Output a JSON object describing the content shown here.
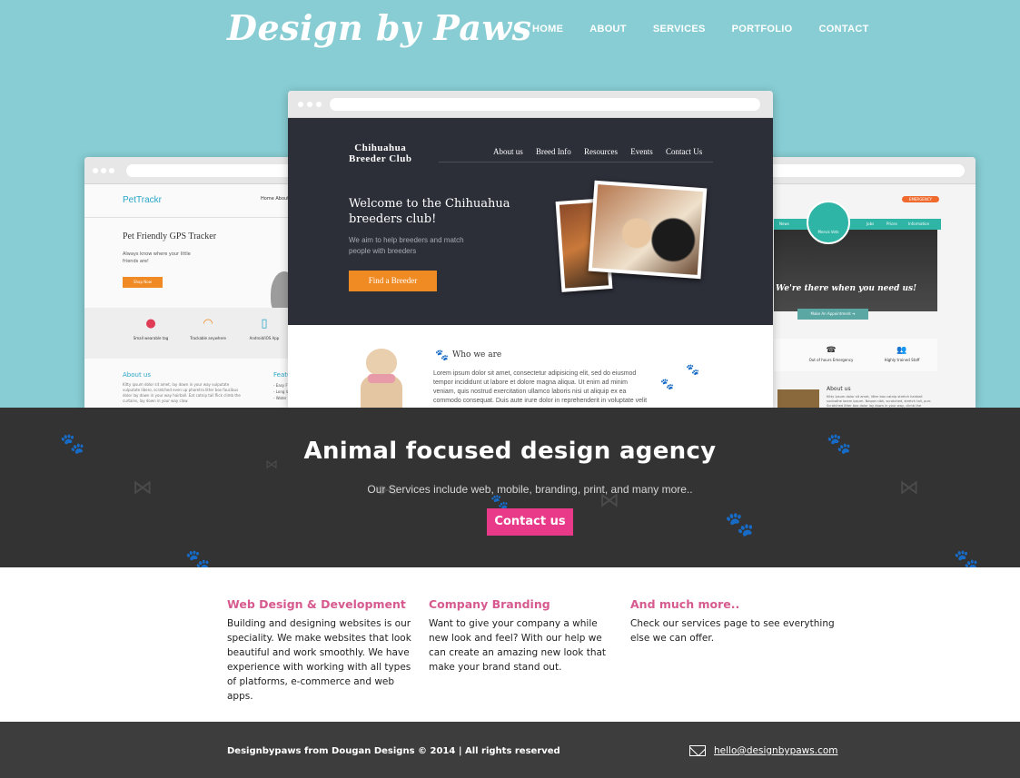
{
  "site": {
    "logo": "Design by Paws",
    "nav": [
      "HOME",
      "ABOUT",
      "SERVICES",
      "PORTFOLIO",
      "CONTACT"
    ]
  },
  "showcase": {
    "left": {
      "logo": "PetTrackr",
      "nav": "Home   About",
      "heading": "Pet Friendly GPS Tracker",
      "text": "Always know where your little friends are!",
      "button": "Shop Now",
      "features": [
        "Small wearable tag",
        "Trackable anywhere",
        "Android/iOS App"
      ],
      "about_title": "About us",
      "about_text": "Kitty ipsum dolor sit amet, lay down in your way vulputate vulputate libero, scratched even up pharetra litter box faucibus dolor lay down in your way hairball. Eat catnip tail flick climb the curtains, lay down in your way claw.",
      "features_title": "Featu",
      "features_list": [
        "- Easy F",
        "- Long la",
        "- Water"
      ]
    },
    "center": {
      "logo_line1": "Chihuahua",
      "logo_line2": "Breeder Club",
      "nav": [
        "About us",
        "Breed Info",
        "Resources",
        "Events",
        "Contact Us"
      ],
      "heading": "Welcome to the Chihuahua breeders club!",
      "text": "We aim to help breeders and match people with breeders",
      "button": "Find a Breeder",
      "who_title": "Who we are",
      "who_text": "Lorem ipsum dolor sit amet, consectetur adipisicing elit, sed do eiusmod tempor incididunt ut labore et dolore magna aliqua. Ut enim ad minim veniam, quis nostrud exercitation ullamco laboris nisi ut aliquip ex ea commodo consequat. Duis aute irure dolor in reprehenderit in voluptate velit esse"
    },
    "right": {
      "emergency": "EMERGENCY",
      "nav": [
        "News",
        "Jobs",
        "Prices",
        "Information"
      ],
      "badge": "Mervis Vets",
      "tagline": "We're there when you need us!",
      "button": "Make An Appointment ➔",
      "features": [
        "Out of hours Emergency",
        "Highly trained Staff"
      ],
      "about_title": "About us",
      "about_text": "Kitty ipsum dolor sit amet, litter box catnip stretch hairball sunbathe lorem ipsum. Neque nibh, scratched, stretch tail, purr. Scratched litter box dolor lay down in your way, climb the curtains, stretching hairball, rip the couch."
    }
  },
  "band": {
    "heading": "Animal focused design agency",
    "text": "Our Services include web, mobile, branding, print, and many more..",
    "button": "Contact us"
  },
  "services": [
    {
      "title": "Web Design & Development",
      "text": "Building and designing websites is our speciality. We make websites that look beautiful and work smoothly. We have experience with working with all types of platforms, e-commerce and web apps."
    },
    {
      "title": "Company Branding",
      "text": "Want to give your company a while new look and feel? With our help we can create an amazing new look that make your brand stand out."
    },
    {
      "title": "And much more..",
      "text": "Check our services page to see everything else we can offer."
    }
  ],
  "footer": {
    "copyright": "Designbypaws from Dougan Designs © 2014 | All rights reserved",
    "email": "hello@designbypaws.com"
  },
  "colors": {
    "hero_bg": "#87cdd3",
    "accent_pink": "#e93a8a",
    "heading_pink": "#d65a8f",
    "dark_band": "#333333",
    "footer_bg": "#3d3d3d",
    "orange": "#f08b24",
    "teal": "#2fb5a6"
  }
}
